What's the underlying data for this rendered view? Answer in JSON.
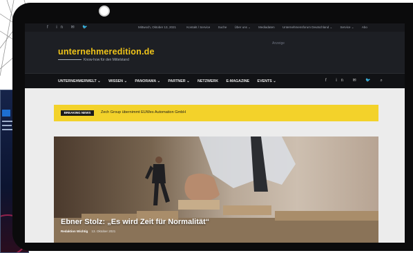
{
  "site": {
    "social_top": "f in ✉ 🐦",
    "top_date": "Mittwoch, Oktober 13, 2021",
    "top_links": [
      "Kontakt / Service",
      "Suche",
      "Über uns ⌄",
      "Mediadaten",
      "Unternehmensforum Deutschland ⌄",
      "Service ⌄",
      "Abo"
    ],
    "logo": "unternehmeredition.de",
    "tagline": "Know-how für den Mittelstand",
    "ad_label": "Anzeige",
    "nav": [
      "UNTERNEHMERWELT ⌄",
      "WISSEN ⌄",
      "PANORAMA ⌄",
      "PARTNER ⌄",
      "NETZWERK",
      "E-MAGAZINE",
      "EVENTS ⌄"
    ],
    "nav_social": "f in ✉ 🐦 ⌕"
  },
  "breaking": {
    "tag": "BREAKING NEWS",
    "text": "Zech Group übernimmt EUWes Automation GmbH"
  },
  "hero": {
    "title": "Ebner Stolz: „Es wird Zeit für Normalität“",
    "author": "Redaktion Wichtig",
    "date": "13. Oktober 2021"
  },
  "colors": {
    "accent": "#f0c419",
    "header": "#1d1f24",
    "breaking": "#f3d22a"
  }
}
